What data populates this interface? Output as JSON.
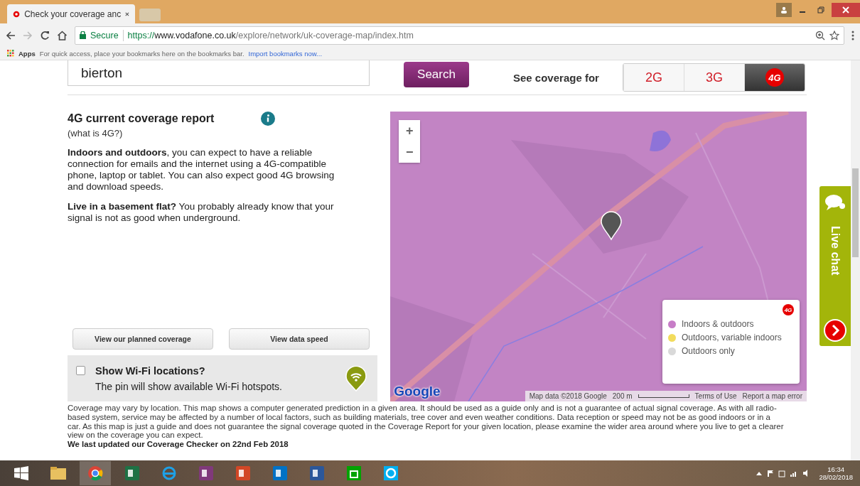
{
  "browser": {
    "tab_title": "Check your coverage anc",
    "address": {
      "secure_label": "Secure",
      "scheme": "https://",
      "host": "www.vodafone.co.uk",
      "path": "/explore/network/uk-coverage-map/index.htm"
    },
    "bookmarks_bar": {
      "apps_label": "Apps",
      "hint": "For quick access, place your bookmarks here on the bookmarks bar.",
      "import_link": "Import bookmarks now..."
    }
  },
  "page": {
    "search": {
      "value": "bierton",
      "button": "Search"
    },
    "coverage_label": "See coverage for",
    "network_tabs": [
      {
        "label": "2G",
        "selected": false
      },
      {
        "label": "3G",
        "selected": false
      },
      {
        "label": "4G",
        "selected": true
      }
    ],
    "report": {
      "title": "4G current coverage report",
      "link": "(what is 4G?)",
      "paragraphs": [
        "**Indoors and outdoors**, you can expect to have a reliable connection for emails and the internet using a 4G-compatible phone, laptop or tablet. You can also expect good 4G browsing and download speeds.",
        "**Live in a basement flat?** You probably already know that your signal is not as good when underground."
      ]
    },
    "buttons": [
      "View our planned coverage",
      "View data speed"
    ],
    "wifi": {
      "checked": false,
      "label": "Show Wi-Fi locations?",
      "hint": "The pin will show available Wi-Fi hotspots."
    },
    "map": {
      "zoom_in": "+",
      "zoom_out": "−",
      "legend": {
        "badge": "4G",
        "items": [
          {
            "label": "Indoors & outdoors",
            "color": "#c77dc7"
          },
          {
            "label": "Outdoors, variable indoors",
            "color": "#f2dc5d"
          },
          {
            "label": "Outdoors only",
            "color": "#d9d9d9"
          }
        ]
      },
      "logo": "Google",
      "attribution": "Map data ©2018 Google",
      "scale": "200 m",
      "terms": "Terms of Use",
      "report_error": "Report a map error"
    },
    "live_chat": {
      "label": "Live chat"
    },
    "disclaimer": "Coverage may vary by location. This map shows a computer generated prediction in a given area. It should be used as a guide only and is not a guarantee of actual signal coverage. As with all radio-based system, service may be affected by a number of local factors, such as building materials, tree cover and even weather conditions. Data reception or speed may not be as good indoors or in a car. As this map is just a guide and does not guarantee the signal coverage quoted in the Coverage Report for your given location, please examine the wider area around where you live to get a clearer view on the coverage you can expect.",
    "last_updated": "We last updated our Coverage Checker on 22nd Feb 2018"
  },
  "taskbar": {
    "time": "16:34",
    "date": "28/02/2018"
  }
}
